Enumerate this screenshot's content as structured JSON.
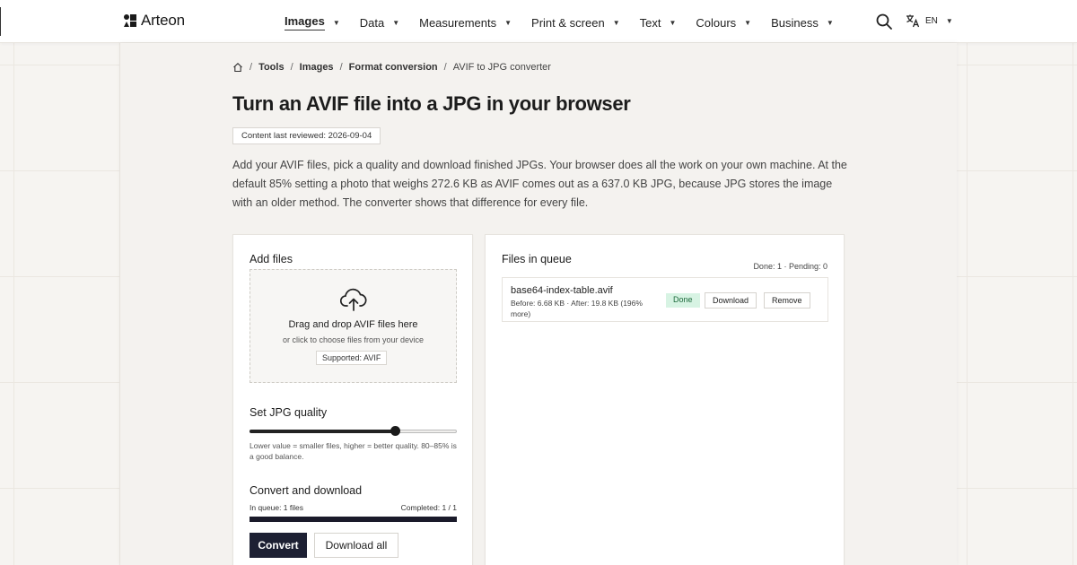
{
  "brand": {
    "name": "Arteon"
  },
  "nav": {
    "items": [
      {
        "label": "Images",
        "active": true
      },
      {
        "label": "Data"
      },
      {
        "label": "Measurements"
      },
      {
        "label": "Print & screen"
      },
      {
        "label": "Text"
      },
      {
        "label": "Colours"
      },
      {
        "label": "Business"
      }
    ],
    "language": "EN"
  },
  "breadcrumb": {
    "items": [
      "Tools",
      "Images",
      "Format conversion"
    ],
    "current": "AVIF to JPG converter"
  },
  "page": {
    "title": "Turn an AVIF file into a JPG in your browser",
    "reviewed": "Content last reviewed: 2026-09-04",
    "intro": "Add your AVIF files, pick a quality and download finished JPGs. Your browser does all the work on your own machine. At the default 85% setting a photo that weighs 272.6 KB as AVIF comes out as a 637.0 KB JPG, because JPG stores the image with an older method. The converter shows that difference for every file."
  },
  "add_files": {
    "title": "Add files",
    "drop_title": "Drag and drop AVIF files here",
    "drop_sub": "or click to choose files from your device",
    "supported": "Supported: AVIF"
  },
  "quality": {
    "title": "Set JPG quality",
    "value": 0.7,
    "hint": "Lower value = smaller files, higher = better quality. 80–85% is a good balance."
  },
  "convert": {
    "title": "Convert and download",
    "in_queue": "In queue: 1 files",
    "completed": "Completed: 1 / 1",
    "progress": 1.0,
    "convert_label": "Convert",
    "download_all_label": "Download all"
  },
  "queue": {
    "title": "Files in queue",
    "counts": "Done: 1 · Pending: 0",
    "files": [
      {
        "name": "base64-index-table.avif",
        "meta": "Before: 6.68 KB · After: 19.8 KB (196% more)",
        "status": "Done",
        "download_label": "Download",
        "remove_label": "Remove"
      }
    ]
  },
  "colors": {
    "primary": "#1d2033",
    "done_bg": "#d7f3e3",
    "done_text": "#1d6a3c"
  }
}
